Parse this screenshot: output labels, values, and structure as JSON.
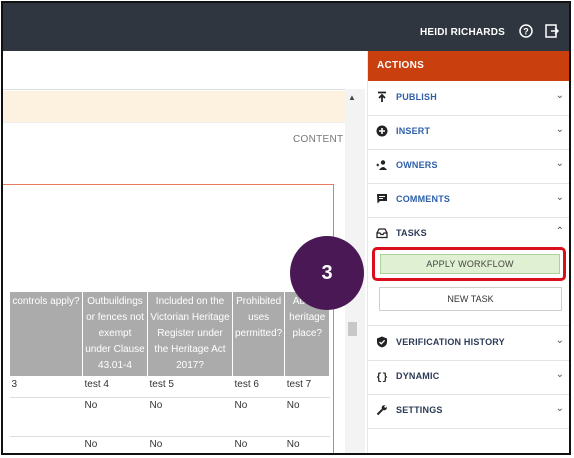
{
  "header": {
    "user_name": "HEIDI RICHARDS"
  },
  "editor": {
    "content_label": "CONTENT",
    "table": {
      "headers": [
        "controls apply?",
        "Outbuildings or fences not exempt under Clause 43.01-4",
        "Included on the Victorian Heritage Register under the Heritage Act 2017?",
        "Prohibited uses permitted?",
        "Aborig heritage place?"
      ],
      "rows": [
        [
          "3",
          "test 4",
          "test 5",
          "test 6",
          "test 7"
        ],
        [
          "",
          "No",
          "No",
          "No",
          "No"
        ],
        [
          "",
          "No",
          "No",
          "No",
          "No"
        ]
      ]
    }
  },
  "actions": {
    "title": "ACTIONS",
    "items": [
      {
        "label": "PUBLISH",
        "icon": "publish-icon"
      },
      {
        "label": "INSERT",
        "icon": "plus-circle-icon"
      },
      {
        "label": "OWNERS",
        "icon": "owners-icon"
      },
      {
        "label": "COMMENTS",
        "icon": "comment-icon"
      },
      {
        "label": "TASKS",
        "icon": "inbox-icon"
      },
      {
        "label": "VERIFICATION HISTORY",
        "icon": "shield-icon"
      },
      {
        "label": "DYNAMIC",
        "icon": "braces-icon"
      },
      {
        "label": "SETTINGS",
        "icon": "wrench-icon"
      }
    ],
    "apply_workflow": "APPLY WORKFLOW",
    "new_task": "NEW TASK"
  },
  "callout": {
    "step": "3",
    "color": "#4a1854"
  },
  "colors": {
    "accent": "#c9400e",
    "highlight": "#d90f1c"
  }
}
